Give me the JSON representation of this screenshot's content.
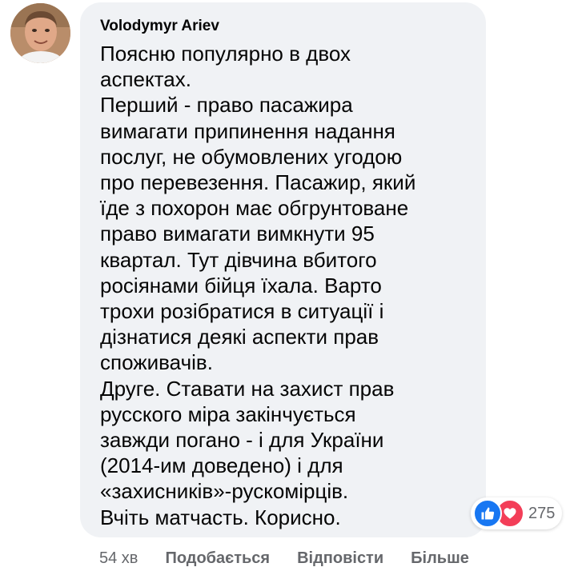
{
  "comment": {
    "author": "Volodymyr Ariev",
    "lines": [
      "Поясню популярно в двох",
      "аспектах.",
      "Перший - право пасажира",
      "вимагати припинення надання",
      "послуг, не обумовлених угодою",
      "про перевезення. Пасажир, який",
      "їде з похорон має обгрунтоване",
      "право вимагати вимкнути 95",
      "квартал. Тут дівчина вбитого",
      "росіянами бійця їхала. Варто",
      "трохи розібратися в ситуації і",
      "дізнатися деякі аспекти прав",
      "споживачів.",
      "Друге. Ставати на захист прав",
      "русского міра закінчується",
      "завжди погано - і для України",
      "(2014-им доведено) і для",
      "«захисників»-рускомірців.",
      "Вчіть матчасть. Корисно."
    ]
  },
  "reactions": {
    "count": "275",
    "icons": [
      "like-icon",
      "love-icon"
    ],
    "like_color": "#1877f2",
    "love_color": "#f33e58"
  },
  "actions": {
    "time": "54 хв",
    "like": "Подобається",
    "reply": "Відповісти",
    "more": "Більше"
  },
  "colors": {
    "bubble": "#f0f2f5",
    "text": "#050505",
    "secondary": "#65676b"
  }
}
